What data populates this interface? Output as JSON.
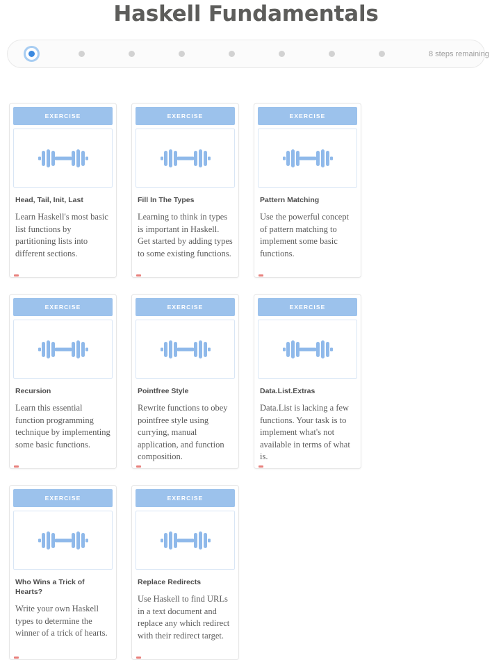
{
  "header": {
    "title": "Haskell Fundamentals"
  },
  "progress": {
    "total_steps": 8,
    "active_index": 0,
    "remaining_label": "8 steps remaining",
    "accent_color": "#3c8ae0",
    "inactive_color": "#d2d2d2"
  },
  "cards": [
    {
      "badge": "EXERCISE",
      "icon": "dumbbell-icon",
      "title": "Head, Tail, Init, Last",
      "description": "Learn Haskell's most basic list functions by partitioning lists into different sections."
    },
    {
      "badge": "EXERCISE",
      "icon": "dumbbell-icon",
      "title": "Fill In The Types",
      "description": "Learning to think in types is important in Haskell. Get started by adding types to some existing functions."
    },
    {
      "badge": "EXERCISE",
      "icon": "dumbbell-icon",
      "title": "Pattern Matching",
      "description": "Use the powerful concept of pattern matching to implement some basic functions."
    },
    {
      "badge": "EXERCISE",
      "icon": "dumbbell-icon",
      "title": "Recursion",
      "description": "Learn this essential function programming technique by implementing some basic functions."
    },
    {
      "badge": "EXERCISE",
      "icon": "dumbbell-icon",
      "title": "Pointfree Style",
      "description": "Rewrite functions to obey pointfree style using currying, manual application, and function composition."
    },
    {
      "badge": "EXERCISE",
      "icon": "dumbbell-icon",
      "title": "Data.List.Extras",
      "description": "Data.List is lacking a few functions. Your task is to implement what's not available in terms of what is."
    },
    {
      "badge": "EXERCISE",
      "icon": "dumbbell-icon",
      "title": "Who Wins a Trick of Hearts?",
      "description": "Write your own Haskell types to determine the winner of a trick of hearts."
    },
    {
      "badge": "EXERCISE",
      "icon": "dumbbell-icon",
      "title": "Replace Redirects",
      "description": "Use Haskell to find URLs in a text document and replace any which redirect with their redirect target."
    }
  ],
  "theme": {
    "banner_blue": "#9cc2ec",
    "icon_blue": "#8fb9ea",
    "title_grey": "#5d5d5b",
    "marker_red": "#e8807c"
  }
}
